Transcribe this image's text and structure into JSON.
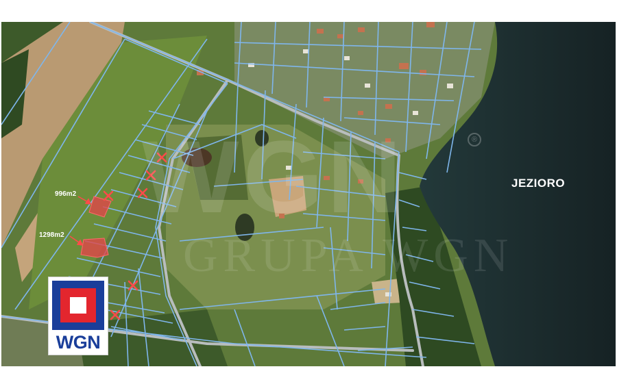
{
  "map": {
    "lake_label": "JEZIORO",
    "plots": [
      {
        "area_label": "996m2"
      },
      {
        "area_label": "1298m2"
      }
    ],
    "brand": {
      "logo_text": "WGN",
      "watermark_text": "WGN",
      "watermark_subtext": "GRUPA WGN",
      "registered_mark": "®"
    },
    "colors": {
      "parcel_lines": "#7fb6ec",
      "highlight_fill": "#e0474a",
      "marker_cross": "#ff4a4a",
      "lake": "#1a2a2c",
      "logo_blue": "#1a3e9a",
      "logo_red": "#e3262e"
    }
  }
}
